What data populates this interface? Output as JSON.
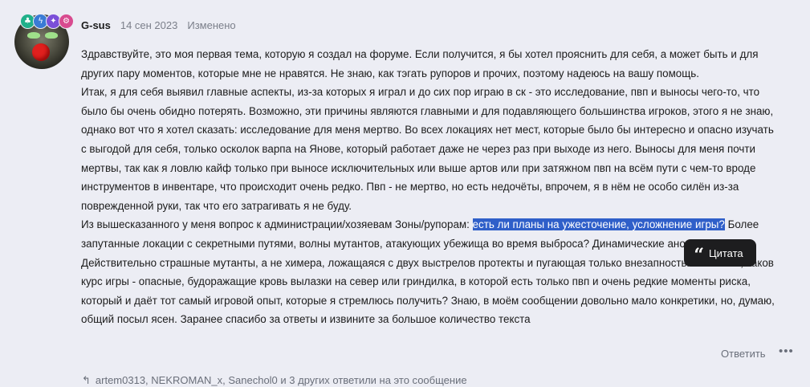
{
  "colors": {
    "background": "#ecedf4",
    "selection": "#2f5fc9",
    "popup": "#1d1d1f"
  },
  "post": {
    "author": "G-sus",
    "date": "14 сен 2023",
    "edited": "Изменено",
    "badges": [
      {
        "icon": "leaf-icon",
        "color": "#20b08a"
      },
      {
        "icon": "bolt-icon",
        "color": "#3a7bd5"
      },
      {
        "icon": "star-icon",
        "color": "#7b4fd8"
      },
      {
        "icon": "gear-icon",
        "color": "#d84b8f"
      }
    ],
    "paragraphs": [
      "Здравствуйте, это моя первая тема, которую я создал на форуме. Если получится, я бы хотел прояснить для себя, а может быть и для других пару моментов, которые мне не нравятся. Не знаю, как тэгать рупоров и прочих, поэтому надеюсь на вашу помощь.",
      "Итак, я для себя выявил главные аспекты, из-за которых я играл и до сих пор играю в ск - это исследование, пвп и выносы чего-то, что было бы очень обидно потерять. Возможно, эти причины являются главными и для подавляющего большинства игроков, этого я не знаю, однако вот что я хотел сказать: исследование для меня мертво. Во всех локациях нет мест, которые было бы интересно и опасно изучать с выгодой для себя, только осколок варпа на Янове, который работает даже не через раз при выходе из него. Выносы для меня почти мертвы, так как я ловлю кайф только при выносе исключительных или выше артов или при затяжном пвп на всём пути с чем-то вроде инструментов в инвентаре, что происходит очень редко. Пвп - не мертво, но есть недочёты, впрочем, я в нём не особо силён из-за поврежденной руки, так что его затрагивать я не буду."
    ],
    "last_paragraph_before": "Из вышесказанного у меня вопрос к администрации/хозяевам Зоны/рупорам: ",
    "selected_text": "есть ли планы на ужесточение, усложнение игры?",
    "last_paragraph_after": " Более запутанные локации с секретными путями, волны мутантов, атакующих убежища во время выброса? Динамические аномалии? Действительно страшные мутанты, а не химера, ложащаяся с двух выстрелов протекты и пугающая только внезапностью? То есть, каков курс игры - опасные, будоражащие кровь вылазки на север или гриндилка, в которой есть только пвп и очень редкие моменты риска, который и даёт тот самый игровой опыт, которые я стремлюсь получить? Знаю, в моём сообщении довольно мало конкретики, но, думаю, общий посыл ясен. Заранее спасибо за ответы и извините за большое количество текста"
  },
  "quote_popup": {
    "icon": "quote-icon",
    "label": "Цитата"
  },
  "actions": {
    "reply_label": "Ответить",
    "more_label": "•••"
  },
  "reactions_text": "artem0313, NEKROMAN_x, Sanechol0 и 3 других ответили на это сообщение"
}
